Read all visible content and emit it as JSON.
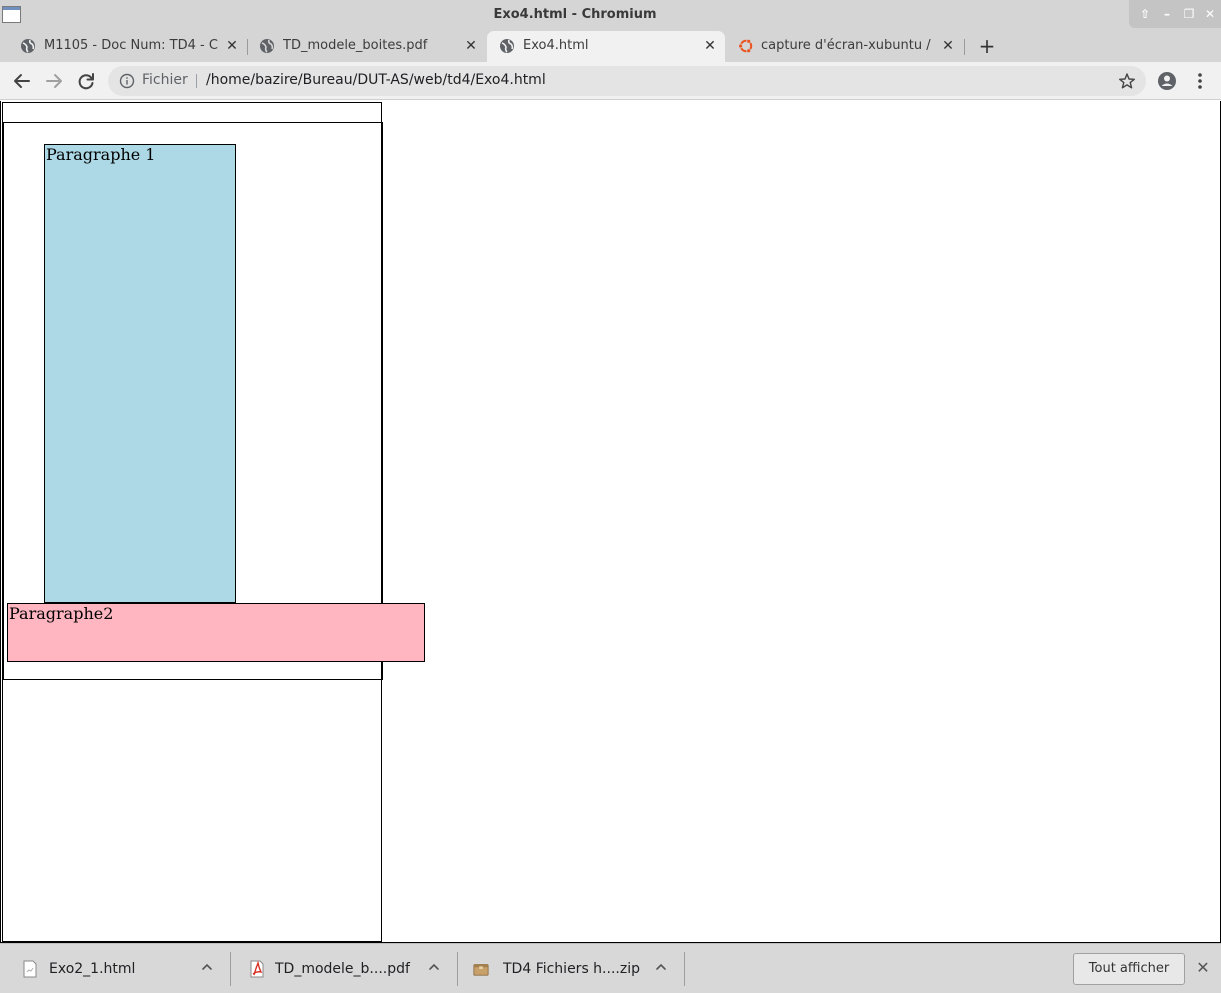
{
  "window": {
    "title": "Exo4.html - Chromium",
    "controls": {
      "up": "⇧",
      "minimize": "–",
      "restore": "❐",
      "close": "✕"
    }
  },
  "tabs": [
    {
      "title": "M1105 - Doc Num: TD4 - C",
      "icon": "globe-icon",
      "close": "✕"
    },
    {
      "title": "TD_modele_boites.pdf",
      "icon": "globe-icon",
      "close": "✕"
    },
    {
      "title": "Exo4.html",
      "icon": "globe-icon",
      "close": "✕",
      "active": true
    },
    {
      "title": "capture d'écran-xubuntu / ",
      "icon": "ubuntu-icon",
      "close": "✕"
    }
  ],
  "new_tab_label": "+",
  "omnibox": {
    "scheme_label": "Fichier",
    "url": "/home/bazire/Bureau/DUT-AS/web/td4/Exo4.html"
  },
  "page": {
    "paragraph1": "Paragraphe 1",
    "paragraph2": "Paragraphe2",
    "colors": {
      "paragraph1_bg": "#add8e6",
      "paragraph2_bg": "#ffb6c1"
    }
  },
  "downloads": {
    "items": [
      {
        "name": "Exo2_1.html",
        "icon": "html-file-icon"
      },
      {
        "name": "TD_modele_b....pdf",
        "icon": "pdf-file-icon"
      },
      {
        "name": "TD4 Fichiers h....zip",
        "icon": "zip-file-icon"
      }
    ],
    "show_all_label": "Tout afficher",
    "close": "✕"
  }
}
